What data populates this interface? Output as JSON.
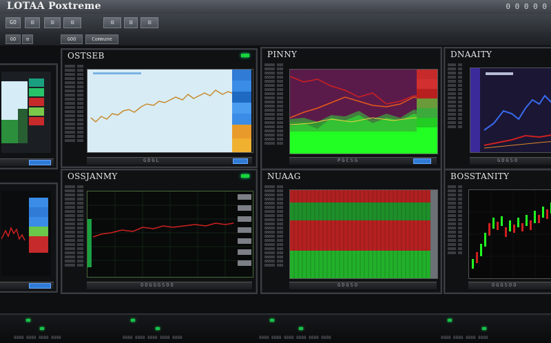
{
  "app": {
    "title": "LOTAA Poxtreme",
    "window_controls": "0 0 0 0 0"
  },
  "toolbar": {
    "buttons": [
      "GO",
      "⊡",
      "⊡",
      "⊡",
      "⊡",
      "⊡",
      "⊡"
    ]
  },
  "toolbar2": {
    "buttons": [
      "GO",
      "⊡",
      "GOO",
      "Commune"
    ]
  },
  "panels": {
    "p1": {
      "title": ""
    },
    "p2": {
      "title": "OSTSEB",
      "footer": "GDGL"
    },
    "p3": {
      "title": "PINNY",
      "footer": "PGCSG"
    },
    "p4": {
      "title": "DNAAITY",
      "footer": "GDGSO"
    },
    "p5": {
      "title": ""
    },
    "p6": {
      "title": "OSSJANMY",
      "footer": "OOGGGSOO"
    },
    "p7": {
      "title": "NUAAG",
      "footer": "GDGSO"
    },
    "p8": {
      "title": "BOSSTANITY",
      "footer": "OGGSOO"
    }
  },
  "colors": {
    "accent_blue": "#2f7bd6",
    "led_green": "#19d63a",
    "up_green": "#22ff22",
    "down_red": "#d02020"
  }
}
